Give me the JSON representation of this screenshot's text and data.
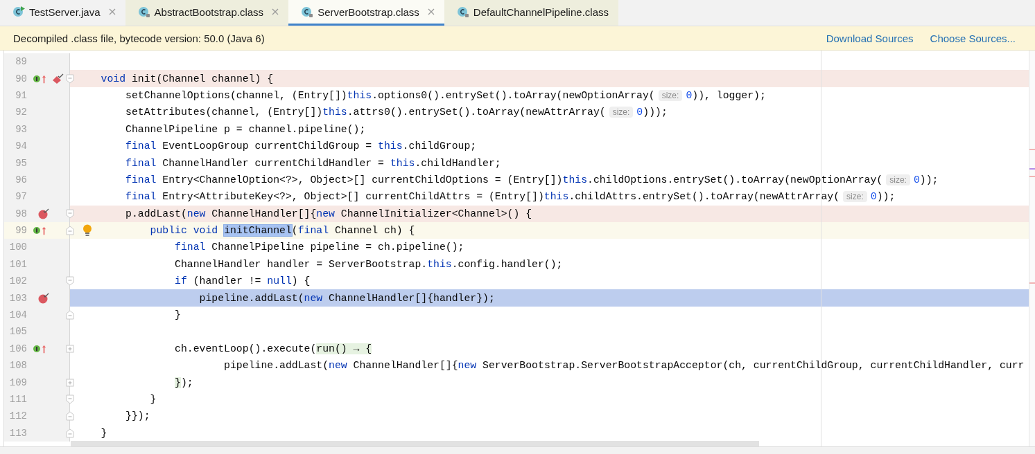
{
  "tabs": [
    {
      "label": "TestServer.java",
      "kind": "source",
      "selected": false,
      "closable": true
    },
    {
      "label": "AbstractBootstrap.class",
      "kind": "library",
      "selected": false,
      "closable": true
    },
    {
      "label": "ServerBootstrap.class",
      "kind": "library",
      "selected": true,
      "closable": true
    },
    {
      "label": "DefaultChannelPipeline.class",
      "kind": "library",
      "selected": false,
      "closable": false
    }
  ],
  "banner": {
    "message": "Decompiled .class file, bytecode version: 50.0 (Java 6)",
    "links": [
      "Download Sources",
      "Choose Sources..."
    ]
  },
  "lines": [
    {
      "number": "89"
    },
    {
      "number": "90",
      "markers": [
        {
          "kind": "implements"
        },
        {
          "kind": "overridden"
        },
        {
          "kind": "method-breakpoint"
        }
      ],
      "fold": {
        "kind": "open"
      },
      "breakpoint_line": true,
      "segments": [
        {
          "t": "    void",
          "kind": "kw"
        },
        {
          "t": " init(Channel channel) {"
        }
      ]
    },
    {
      "number": "91",
      "segments": [
        {
          "t": "        setChannelOptions(channel, (Entry[])"
        },
        {
          "t": "this",
          "kind": "kw"
        },
        {
          "t": ".options0().entrySet().toArray(newOptionArray("
        },
        {
          "t": "size:",
          "kind": "hint"
        },
        {
          "t": "0",
          "kind": "num"
        },
        {
          "t": ")), logger);"
        }
      ]
    },
    {
      "number": "92",
      "segments": [
        {
          "t": "        setAttributes(channel, (Entry[])"
        },
        {
          "t": "this",
          "kind": "kw"
        },
        {
          "t": ".attrs0().entrySet().toArray(newAttrArray("
        },
        {
          "t": "size:",
          "kind": "hint"
        },
        {
          "t": "0",
          "kind": "num"
        },
        {
          "t": ")));"
        }
      ]
    },
    {
      "number": "93",
      "segments": [
        {
          "t": "        ChannelPipeline p = channel.pipeline();"
        }
      ]
    },
    {
      "number": "94",
      "segments": [
        {
          "t": "        final",
          "kind": "kw"
        },
        {
          "t": " EventLoopGroup currentChildGroup = "
        },
        {
          "t": "this",
          "kind": "kw"
        },
        {
          "t": ".childGroup;"
        }
      ]
    },
    {
      "number": "95",
      "segments": [
        {
          "t": "        final",
          "kind": "kw"
        },
        {
          "t": " ChannelHandler currentChildHandler = "
        },
        {
          "t": "this",
          "kind": "kw"
        },
        {
          "t": ".childHandler;"
        }
      ]
    },
    {
      "number": "96",
      "segments": [
        {
          "t": "        final",
          "kind": "kw"
        },
        {
          "t": " Entry<ChannelOption<?>, Object>[] currentChildOptions = (Entry[])"
        },
        {
          "t": "this",
          "kind": "kw"
        },
        {
          "t": ".childOptions.entrySet().toArray(newOptionArray("
        },
        {
          "t": "size:",
          "kind": "hint"
        },
        {
          "t": "0",
          "kind": "num"
        },
        {
          "t": "));"
        }
      ]
    },
    {
      "number": "97",
      "segments": [
        {
          "t": "        final",
          "kind": "kw"
        },
        {
          "t": " Entry<AttributeKey<?>, Object>[] currentChildAttrs = (Entry[])"
        },
        {
          "t": "this",
          "kind": "kw"
        },
        {
          "t": ".childAttrs.entrySet().toArray(newAttrArray("
        },
        {
          "t": "size:",
          "kind": "hint"
        },
        {
          "t": "0",
          "kind": "num"
        },
        {
          "t": "));"
        }
      ]
    },
    {
      "number": "98",
      "markers": [
        {
          "kind": "breakpoint"
        }
      ],
      "fold": {
        "kind": "open"
      },
      "breakpoint_line": true,
      "segments": [
        {
          "t": "        p.addLast("
        },
        {
          "t": "new",
          "kind": "kw"
        },
        {
          "t": " ChannelHandler[]{"
        },
        {
          "t": "new",
          "kind": "kw"
        },
        {
          "t": " ChannelInitializer<Channel>() {"
        }
      ]
    },
    {
      "number": "99",
      "markers": [
        {
          "kind": "implements"
        },
        {
          "kind": "overridden"
        }
      ],
      "fold": {
        "kind": "close"
      },
      "caret_line": true,
      "bulb": true,
      "segments": [
        {
          "t": "            public void ",
          "kind": "kw"
        },
        {
          "t": "initChannel",
          "kind": "sel"
        },
        {
          "t": "("
        },
        {
          "t": "final",
          "kind": "kw"
        },
        {
          "t": " Channel ch) {"
        }
      ]
    },
    {
      "number": "100",
      "segments": [
        {
          "t": "                final",
          "kind": "kw"
        },
        {
          "t": " ChannelPipeline pipeline = ch.pipeline();"
        }
      ]
    },
    {
      "number": "101",
      "segments": [
        {
          "t": "                ChannelHandler handler = ServerBootstrap."
        },
        {
          "t": "this",
          "kind": "kw"
        },
        {
          "t": ".config.handler();"
        }
      ]
    },
    {
      "number": "102",
      "fold": {
        "kind": "open"
      },
      "segments": [
        {
          "t": "                if",
          "kind": "kw"
        },
        {
          "t": " (handler != "
        },
        {
          "t": "null",
          "kind": "kw"
        },
        {
          "t": ") {"
        }
      ]
    },
    {
      "number": "103",
      "markers": [
        {
          "kind": "breakpoint"
        }
      ],
      "selected": true,
      "segments": [
        {
          "t": "                    pipeline.addLast("
        },
        {
          "t": "new",
          "kind": "kw"
        },
        {
          "t": " ChannelHandler[]{handler});"
        }
      ]
    },
    {
      "number": "104",
      "fold": {
        "kind": "close"
      },
      "segments": [
        {
          "t": "                }"
        }
      ]
    },
    {
      "number": "105"
    },
    {
      "number": "106",
      "markers": [
        {
          "kind": "implements"
        },
        {
          "kind": "overridden"
        }
      ],
      "fold": {
        "kind": "collapsed"
      },
      "segments": [
        {
          "t": "                ch.eventLoop().execute("
        },
        {
          "t": "run() → {",
          "kind": "lambda"
        }
      ]
    },
    {
      "number": "108",
      "segments": [
        {
          "t": "                        pipeline.addLast("
        },
        {
          "t": "new",
          "kind": "kw"
        },
        {
          "t": " ChannelHandler[]{"
        },
        {
          "t": "new",
          "kind": "kw"
        },
        {
          "t": " ServerBootstrap.ServerBootstrapAcceptor(ch, currentChildGroup, currentChildHandler, curr"
        }
      ]
    },
    {
      "number": "109",
      "fold": {
        "kind": "collapsed"
      },
      "segments": [
        {
          "t": "                }",
          "kind": "lambda"
        },
        {
          "t": ");"
        }
      ]
    },
    {
      "number": "111",
      "fold": {
        "kind": "open"
      },
      "segments": [
        {
          "t": "            }"
        }
      ]
    },
    {
      "number": "112",
      "fold": {
        "kind": "close"
      },
      "segments": [
        {
          "t": "        }});"
        }
      ]
    },
    {
      "number": "113",
      "fold": {
        "kind": "close"
      },
      "segments": [
        {
          "t": "    }"
        }
      ]
    }
  ]
}
